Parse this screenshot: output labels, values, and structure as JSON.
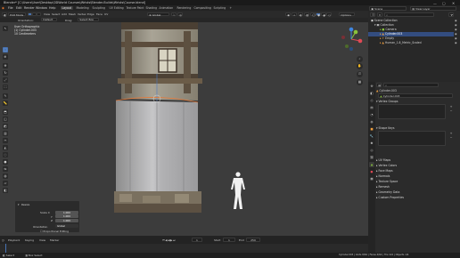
{
  "window": {
    "title": "Blender* [C:\\Users\\User\\Desktop\\3DWorld Courses\\Wrists\\Blender-Builds\\Wrists\\Course.blend]",
    "controls": [
      "—",
      "▢",
      "✕"
    ]
  },
  "menubar": {
    "menus": [
      "File",
      "Edit",
      "Render",
      "Window",
      "Help"
    ],
    "workspaces": [
      "Layout",
      "Modeling",
      "Sculpting",
      "UV Editing",
      "Texture Paint",
      "Shading",
      "Animation",
      "Rendering",
      "Compositing",
      "Scripting"
    ],
    "active_workspace": "Layout",
    "scene": "Scene",
    "view_layer": "View Layer"
  },
  "viewport_header": {
    "mode": "Edit Mode",
    "view": "View",
    "select": "Select",
    "add": "Add",
    "mesh": "Mesh",
    "vertex": "Vertex",
    "edge": "Edge",
    "face": "Face",
    "uv": "UV",
    "orientation_label": "Orientation:",
    "orientation": "Default",
    "drag_label": "Drag:",
    "drag": "Select Box",
    "pivot": "Global",
    "options": "Options"
  },
  "viewport": {
    "view_name": "User Orthographic",
    "object_info": "(1) Cylinder.003",
    "units": "10 Centimeters",
    "gizmo": {
      "x": "X",
      "y": "Y",
      "z": "Z"
    }
  },
  "redo_panel": {
    "title": "Resize",
    "scale_label": "Scale X",
    "scale_y_label": "Y",
    "scale_z_label": "Z",
    "scale_x": "1.000",
    "scale_y": "1.000",
    "scale_z": "1.000",
    "orientation_label": "Orientation",
    "orientation": "Global",
    "prop_edit": "Proportional Editing"
  },
  "timeline": {
    "playback": "Playback",
    "keying": "Keying",
    "view": "View",
    "marker": "Marker",
    "current_frame": "1",
    "start_label": "Start",
    "start": "1",
    "end_label": "End",
    "end": "250"
  },
  "outliner": {
    "search_placeholder": "",
    "items": [
      {
        "label": "Scene Collection",
        "indent": 0,
        "selected": false
      },
      {
        "label": "Collection",
        "indent": 1,
        "selected": false
      },
      {
        "label": "Camera",
        "indent": 2,
        "selected": false
      },
      {
        "label": "Cylinder.003",
        "indent": 2,
        "selected": true
      },
      {
        "label": "Empty",
        "indent": 2,
        "selected": false
      },
      {
        "label": "Human_1.8_Metric_Scaled",
        "indent": 2,
        "selected": false
      }
    ]
  },
  "properties": {
    "object_name": "Cylinder.003",
    "mesh_name": "Cylinder.003",
    "sections_open": [
      "Vertex Groups",
      "Shape Keys"
    ],
    "sections_closed": [
      "UV Maps",
      "Vertex Colors",
      "Face Maps",
      "Normals",
      "Texture Space",
      "Remesh",
      "Geometry Data",
      "Custom Properties"
    ]
  },
  "status": {
    "left": "Select",
    "middle": "Box Select",
    "right": "Cylinder.003 | Verts 8/64 | Faces 4/62 | Tris 124 | Objects 1/4"
  },
  "colors": {
    "accent": "#4773b3",
    "selection": "#334d80",
    "viewport_bg": "#3c3c3c",
    "panel_bg": "#2b2b2b"
  }
}
